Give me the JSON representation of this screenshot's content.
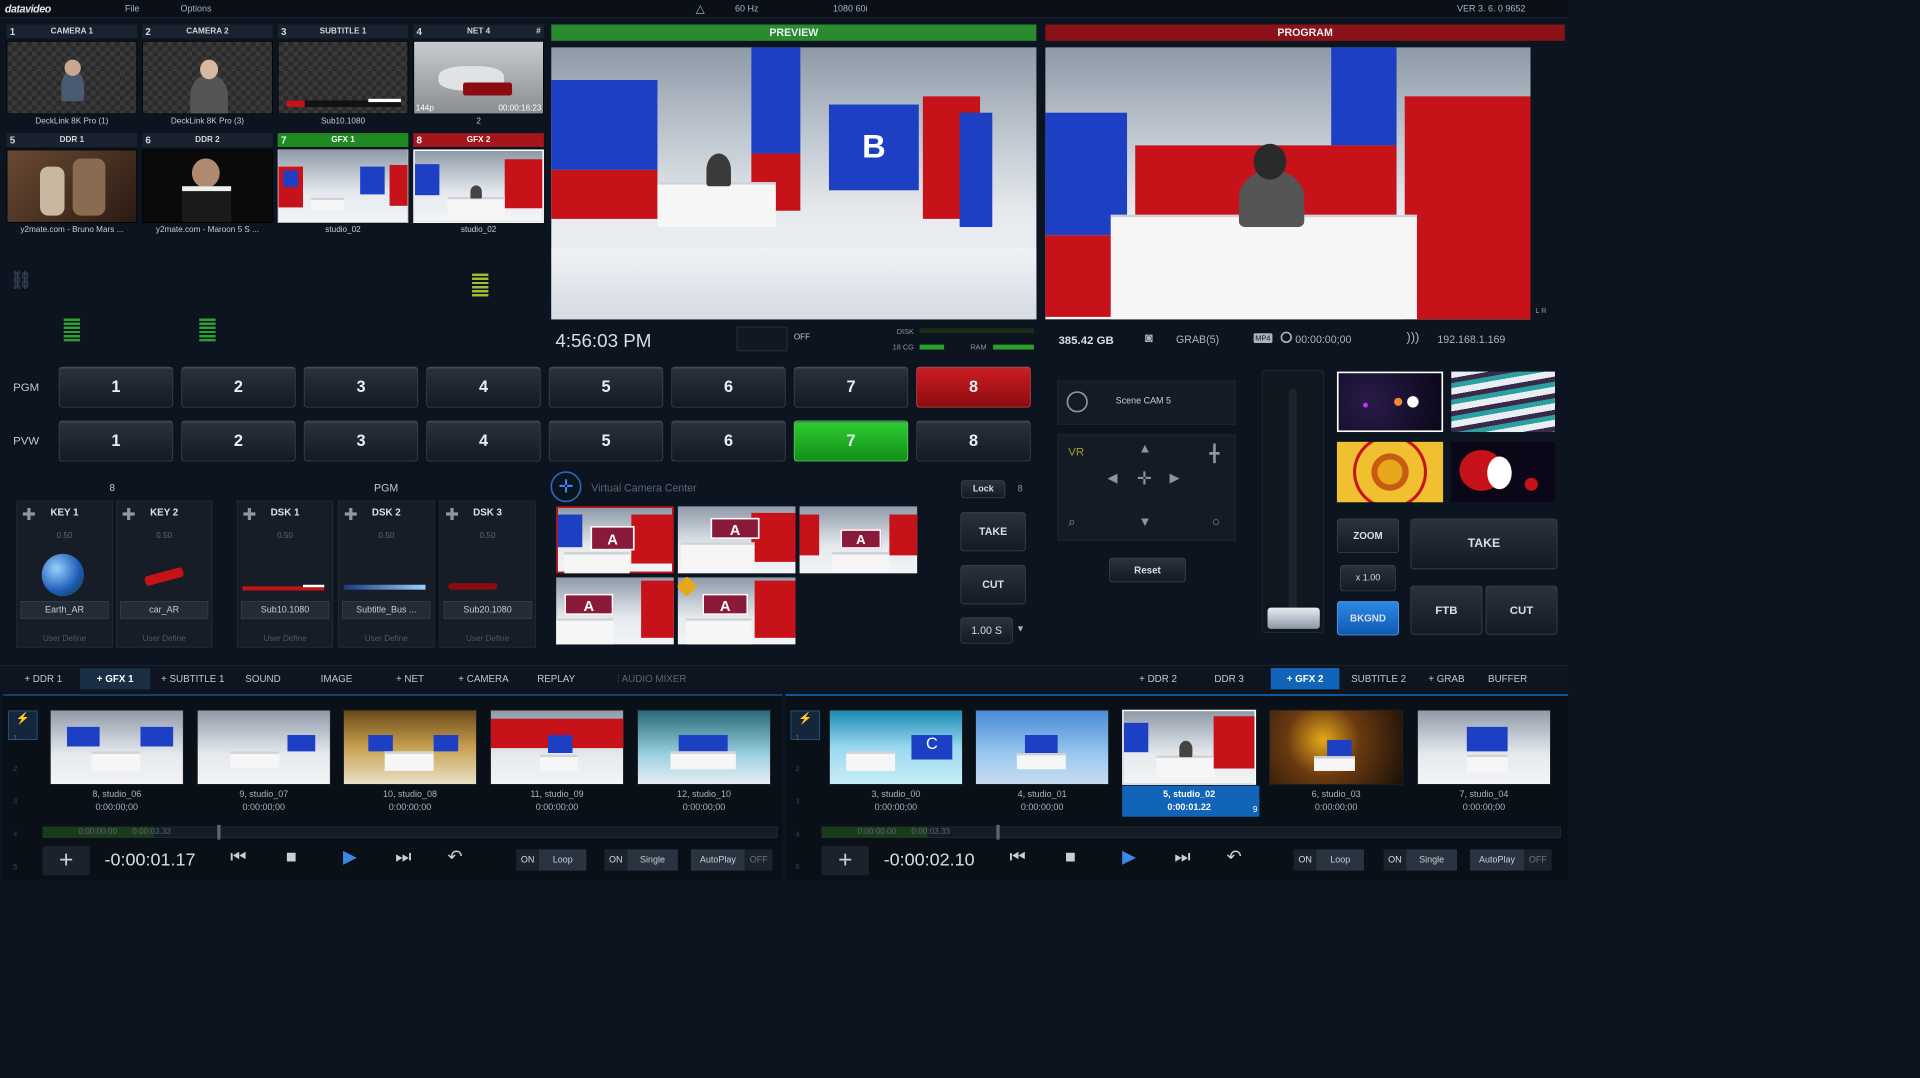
{
  "topbar": {
    "logo": "datavideo",
    "menu": [
      "File",
      "Options"
    ],
    "hz": "60 Hz",
    "format": "1080 60i",
    "version": "VER 3. 6. 0 9652"
  },
  "sources": [
    {
      "num": "1",
      "name": "CAMERA 1",
      "caption": "DeckLink 8K Pro (1)"
    },
    {
      "num": "2",
      "name": "CAMERA 2",
      "caption": "DeckLink 8K Pro (3)"
    },
    {
      "num": "3",
      "name": "SUBTITLE 1",
      "caption": "Sub10.1080"
    },
    {
      "num": "4",
      "name": "NET 4",
      "caption": "2",
      "extra": "#",
      "overlay_left": "144p",
      "overlay_right": "00:00:16:23"
    },
    {
      "num": "5",
      "name": "DDR 1",
      "caption": "y2mate.com - Bruno Mars ..."
    },
    {
      "num": "6",
      "name": "DDR 2",
      "caption": "y2mate.com - Maroon 5  S ..."
    },
    {
      "num": "7",
      "name": "GFX 1",
      "caption": "studio_02"
    },
    {
      "num": "8",
      "name": "GFX 2",
      "caption": "studio_02"
    }
  ],
  "preview": {
    "label": "PREVIEW",
    "wall_letter": "B"
  },
  "program": {
    "label": "PROGRAM"
  },
  "status": {
    "clock": "4:56:03 PM",
    "rec_off": "OFF",
    "disk_label": "DISK",
    "disk_size": "18 CG",
    "ram_label": "RAM",
    "storage": "385.42 GB",
    "grab": "GRAB(5)",
    "rec_badge": "MP4",
    "rec_time": "00:00:00;00",
    "ip": "192.168.1.169"
  },
  "pgm": {
    "label": "PGM",
    "buttons": [
      "1",
      "2",
      "3",
      "4",
      "5",
      "6",
      "7",
      "8"
    ],
    "active": "8"
  },
  "pvw": {
    "label": "PVW",
    "buttons": [
      "1",
      "2",
      "3",
      "4",
      "5",
      "6",
      "7",
      "8"
    ],
    "active": "7"
  },
  "keys": {
    "group1_label": "8",
    "group2_label": "PGM",
    "items": [
      {
        "title": "KEY 1",
        "value": "0.50",
        "source": "Earth_AR",
        "user": "User Define"
      },
      {
        "title": "KEY 2",
        "value": "0.50",
        "source": "car_AR",
        "user": "User Define"
      },
      {
        "title": "DSK 1",
        "value": "0.50",
        "source": "Sub10.1080",
        "user": "User Define"
      },
      {
        "title": "DSK 2",
        "value": "0.50",
        "source": "Subtitle_Bus ...",
        "user": "User Define"
      },
      {
        "title": "DSK 3",
        "value": "0.50",
        "source": "Sub20.1080",
        "user": "User Define"
      }
    ]
  },
  "vcc": {
    "title": "Virtual Camera Center",
    "lock": "Lock",
    "lock_num": "8",
    "take": "TAKE",
    "cut": "CUT",
    "duration": "1.00 S",
    "scene_letter": "A"
  },
  "camera": {
    "scene": "Scene CAM 5",
    "vr": "VR",
    "reset": "Reset"
  },
  "transition": {
    "zoom": "ZOOM",
    "zoom_val": "x 1.00",
    "bkgnd": "BKGND",
    "take": "TAKE",
    "ftb": "FTB",
    "cut": "CUT"
  },
  "tabs_left": [
    "+ DDR 1",
    "+ GFX 1",
    "+ SUBTITLE 1",
    "SOUND",
    "IMAGE",
    "+ NET",
    "+ CAMERA",
    "REPLAY",
    "AUDIO MIXER"
  ],
  "tabs_right": [
    "+ DDR 2",
    "DDR 3",
    "+ GFX 2",
    "SUBTITLE 2",
    "+ GRAB",
    "BUFFER"
  ],
  "playlist_left": [
    {
      "name": "8, studio_06",
      "time": "0:00:00;00"
    },
    {
      "name": "9, studio_07",
      "time": "0:00:00;00"
    },
    {
      "name": "10, studio_08",
      "time": "0:00:00;00"
    },
    {
      "name": "11, studio_09",
      "time": "0:00:00;00"
    },
    {
      "name": "12, studio_10",
      "time": "0:00:00;00"
    }
  ],
  "playlist_right": [
    {
      "name": "3, studio_00",
      "time": "0:00:00;00"
    },
    {
      "name": "4, studio_01",
      "time": "0:00:00;00"
    },
    {
      "name": "5, studio_02",
      "time": "0:00:01.22",
      "badge": "9"
    },
    {
      "name": "6, studio_03",
      "time": "0:00:00;00"
    },
    {
      "name": "7, studio_04",
      "time": "0:00:00;00"
    }
  ],
  "player_left": {
    "counter": "-0:00:01.17",
    "range_a": "0:00:00.00",
    "range_b": "0:00:03.33",
    "on1": "ON",
    "loop": "Loop",
    "on2": "ON",
    "single": "Single",
    "autoplay": "AutoPlay",
    "off": "OFF"
  },
  "player_right": {
    "counter": "-0:00:02.10",
    "range_a": "0:00:00.00",
    "range_b": "0:00:03.33",
    "on1": "ON",
    "loop": "Loop",
    "on2": "ON",
    "single": "Single",
    "autoplay": "AutoPlay",
    "off": "OFF"
  },
  "row_nums": [
    "1",
    "2",
    "3",
    "4",
    "5"
  ]
}
